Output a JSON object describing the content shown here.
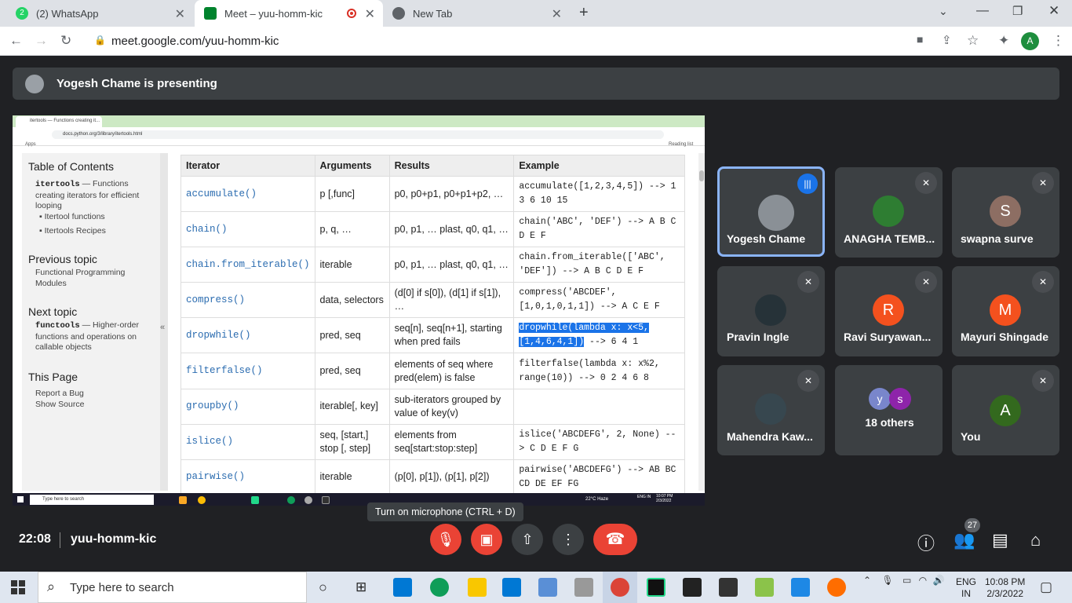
{
  "browser": {
    "tabs": [
      {
        "label": "(2) WhatsApp",
        "badge": "2"
      },
      {
        "label": "Meet – yuu-homm-kic"
      },
      {
        "label": "New Tab"
      }
    ],
    "url": "meet.google.com/yuu-homm-kic",
    "profile_initial": "A"
  },
  "meet": {
    "presenting_text": "Yogesh Chame is presenting",
    "shared": {
      "tab_title": "itertools — Functions creating it...",
      "url": "docs.python.org/3/library/itertools.html",
      "apps_label": "Apps",
      "reading_list": "Reading list",
      "sidebar": {
        "toc_heading": "Table of Contents",
        "toc_item_code": "itertools",
        "toc_item_text": " — Functions creating iterators for efficient looping",
        "toc_sub1": "Itertool functions",
        "toc_sub2": "Itertools Recipes",
        "prev_heading": "Previous topic",
        "prev_link": "Functional Programming Modules",
        "next_heading": "Next topic",
        "next_code": "functools",
        "next_text": " — Higher-order functions and operations on callable objects",
        "page_heading": "This Page",
        "report": "Report a Bug",
        "source": "Show Source",
        "collapse": "«"
      },
      "table": {
        "headers": [
          "Iterator",
          "Arguments",
          "Results",
          "Example"
        ],
        "rows": [
          [
            "accumulate()",
            "p [,func]",
            "p0, p0+p1, p0+p1+p2, …",
            "accumulate([1,2,3,4,5]) --> 1 3 6 10 15"
          ],
          [
            "chain()",
            "p, q, …",
            "p0, p1, … plast, q0, q1, …",
            "chain('ABC', 'DEF') --> A B C D E F"
          ],
          [
            "chain.from_iterable()",
            "iterable",
            "p0, p1, … plast, q0, q1, …",
            "chain.from_iterable(['ABC', 'DEF']) --> A B C D E F"
          ],
          [
            "compress()",
            "data, selectors",
            "(d[0] if s[0]), (d[1] if s[1]), …",
            "compress('ABCDEF', [1,0,1,0,1,1]) --> A C E F"
          ],
          [
            "dropwhile()",
            "pred, seq",
            "seq[n], seq[n+1], starting when pred fails",
            "dropwhile(lambda x: x<5, [1,4,6,4,1])",
            " --> 6 4 1"
          ],
          [
            "filterfalse()",
            "pred, seq",
            "elements of seq where pred(elem) is false",
            "filterfalse(lambda x: x%2, range(10)) --> 0 2 4 6 8"
          ],
          [
            "groupby()",
            "iterable[, key]",
            "sub-iterators grouped by value of key(v)",
            ""
          ],
          [
            "islice()",
            "seq, [start,] stop [, step]",
            "elements from seq[start:stop:step]",
            "islice('ABCDEFG', 2, None) --> C D E F G"
          ],
          [
            "pairwise()",
            "iterable",
            "(p[0], p[1]), (p[1], p[2])",
            "pairwise('ABCDEFG') --> AB BC CD DE EF FG"
          ]
        ]
      },
      "taskbar_search": "Type here to search",
      "weather": "22°C Haze",
      "lang": "ENG IN",
      "time": "10:07 PM",
      "date": "2/3/2022"
    },
    "tooltip": "Turn on microphone (CTRL + D)",
    "participants": [
      {
        "name": "Yogesh Chame",
        "speaking": true
      },
      {
        "name": "ANAGHA TEMB..."
      },
      {
        "name": "swapna surve",
        "initial": "S",
        "color": "#8d6e63"
      },
      {
        "name": "Pravin Ingle"
      },
      {
        "name": "Ravi Suryawan...",
        "initial": "R",
        "color": "#f4511e"
      },
      {
        "name": "Mayuri Shingade",
        "initial": "M",
        "color": "#f4511e"
      },
      {
        "name": "Mahendra Kaw..."
      },
      {
        "name": "18 others",
        "initials": [
          "y",
          "s"
        ]
      },
      {
        "name": "You",
        "initial": "A",
        "color": "#33691e"
      }
    ],
    "clock": "22:08",
    "meeting_code": "yuu-homm-kic",
    "people_count": "27"
  },
  "taskbar": {
    "search_placeholder": "Type here to search",
    "lang_top": "ENG",
    "lang_bottom": "IN",
    "time": "10:08 PM",
    "date": "2/3/2022"
  }
}
